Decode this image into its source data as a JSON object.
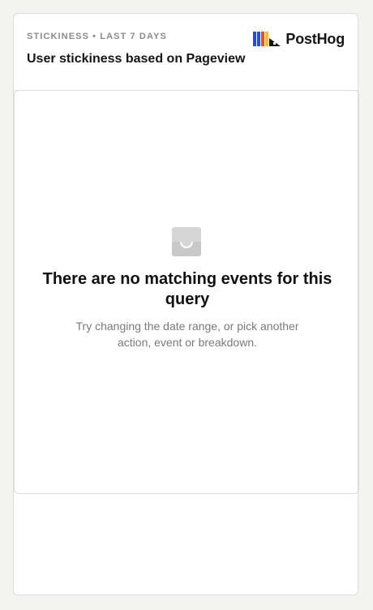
{
  "header": {
    "eyebrow": "STICKINESS • LAST 7 DAYS",
    "title": "User stickiness based on Pageview",
    "logo_text": "PostHog"
  },
  "empty_state": {
    "icon": "inbox-icon",
    "title": "There are no matching events for this query",
    "description": "Try changing the date range, or pick another action, event or breakdown."
  },
  "colors": {
    "logo_blue": "#1d4aff",
    "logo_orange": "#f54e00",
    "logo_yellow": "#f9bd2b",
    "logo_black": "#151515"
  }
}
